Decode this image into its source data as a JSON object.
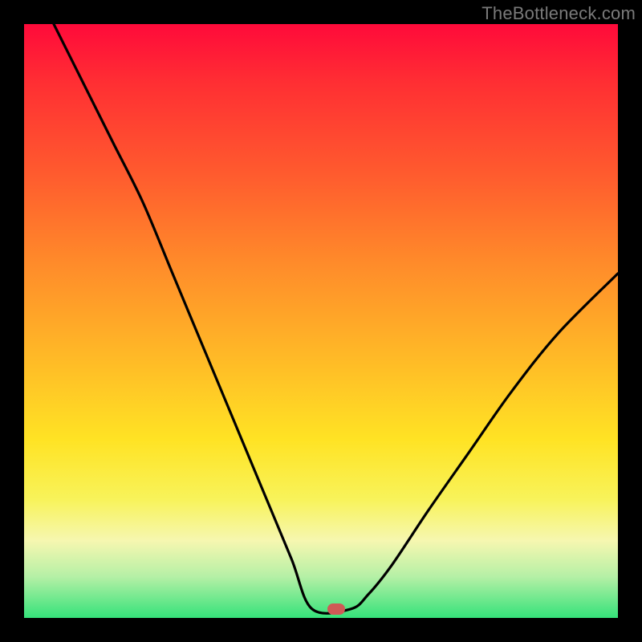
{
  "watermark": "TheBottleneck.com",
  "marker": {
    "x_frac": 0.525,
    "y_frac": 0.985
  },
  "chart_data": {
    "type": "line",
    "title": "",
    "xlabel": "",
    "ylabel": "",
    "xlim": [
      0,
      1
    ],
    "ylim": [
      0,
      1
    ],
    "grid": false,
    "legend": false,
    "background_gradient": {
      "direction": "top-to-bottom",
      "stops": [
        {
          "pos": 0.0,
          "color": "#ff0a3a"
        },
        {
          "pos": 0.1,
          "color": "#ff2f33"
        },
        {
          "pos": 0.25,
          "color": "#ff5a2e"
        },
        {
          "pos": 0.4,
          "color": "#ff8a2a"
        },
        {
          "pos": 0.55,
          "color": "#ffb627"
        },
        {
          "pos": 0.7,
          "color": "#ffe324"
        },
        {
          "pos": 0.8,
          "color": "#f8f35a"
        },
        {
          "pos": 0.87,
          "color": "#f6f7b0"
        },
        {
          "pos": 0.93,
          "color": "#b6f0a6"
        },
        {
          "pos": 1.0,
          "color": "#35e27a"
        }
      ]
    },
    "series": [
      {
        "name": "bottleneck-curve",
        "color": "#000000",
        "stroke_width": 3,
        "x": [
          0.05,
          0.1,
          0.15,
          0.2,
          0.25,
          0.3,
          0.35,
          0.4,
          0.45,
          0.485,
          0.55,
          0.58,
          0.62,
          0.68,
          0.75,
          0.82,
          0.9,
          1.0
        ],
        "values": [
          1.0,
          0.9,
          0.8,
          0.7,
          0.58,
          0.46,
          0.34,
          0.22,
          0.1,
          0.015,
          0.015,
          0.04,
          0.09,
          0.18,
          0.28,
          0.38,
          0.48,
          0.58
        ]
      }
    ],
    "marker_point": {
      "x": 0.525,
      "y": 0.015,
      "color": "#cf5a56",
      "shape": "rounded-rect"
    }
  }
}
